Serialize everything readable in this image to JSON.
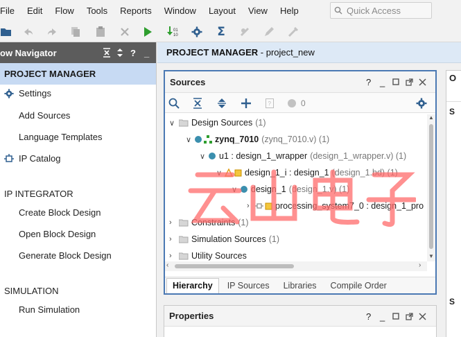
{
  "menu": [
    "File",
    "Edit",
    "Flow",
    "Tools",
    "Reports",
    "Window",
    "Layout",
    "View",
    "Help"
  ],
  "quick_access": {
    "placeholder": "Quick Access"
  },
  "flow_navigator": {
    "title": "ow Navigator",
    "project_manager": "PROJECT MANAGER",
    "settings": "Settings",
    "add_sources": "Add Sources",
    "language_templates": "Language Templates",
    "ip_catalog": "IP Catalog",
    "ip_integrator": "IP INTEGRATOR",
    "create_block_design": "Create Block Design",
    "open_block_design": "Open Block Design",
    "generate_block_design": "Generate Block Design",
    "simulation": "SIMULATION",
    "run_simulation": "Run Simulation"
  },
  "main": {
    "title_bold": "PROJECT MANAGER",
    "title_rest": " - project_new"
  },
  "sources": {
    "title": "Sources",
    "count": "0",
    "tree": {
      "design_sources": "Design Sources",
      "design_sources_count": "(1)",
      "top": "zynq_7010",
      "top_file": "(zynq_7010.v) (1)",
      "u1": "u1 : design_1_wrapper",
      "u1_file": "(design_1_wrapper.v) (1)",
      "design_1_i": "design_1_i : design_1",
      "design_1_i_file": "(design_1.bd) (1)",
      "design_1": "design_1",
      "design_1_file": "(design_1.v) (1)",
      "ps7": "processing_system7_0 : design_1_pro",
      "constraints": "Constraints",
      "constraints_count": "(1)",
      "sim_sources": "Simulation Sources",
      "sim_sources_count": "(1)",
      "utility_sources": "Utility Sources"
    },
    "tabs": [
      "Hierarchy",
      "IP Sources",
      "Libraries",
      "Compile Order"
    ]
  },
  "properties": {
    "title": "Properties"
  },
  "right_pane": {
    "label1": "O",
    "label2": "S"
  },
  "watermark": "云山电子",
  "colors": {
    "accent": "#4a78b3",
    "selected": "#c7daf3",
    "run": "#2e9e2e",
    "header": "#5c5c5c"
  }
}
